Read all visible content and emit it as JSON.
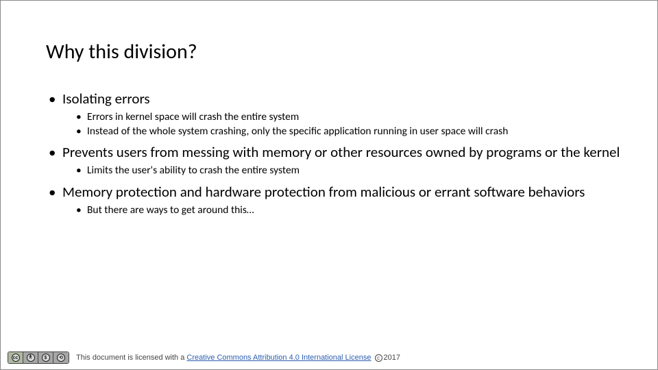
{
  "slide": {
    "title": "Why this division?",
    "bullets": [
      {
        "text": "Isolating errors",
        "children": [
          "Errors in kernel space will crash the entire system",
          "Instead of the whole system crashing, only the specific application running in user space will crash"
        ]
      },
      {
        "text": "Prevents users from messing with memory or other resources owned by programs or the kernel",
        "children": [
          "Limits the user's ability to crash the entire system"
        ]
      },
      {
        "text": "Memory protection and hardware protection from malicious or errant software behaviors",
        "children": [
          "But there are ways to get around this…"
        ]
      }
    ]
  },
  "footer": {
    "prefix": "This document is licensed with a ",
    "link_text": "Creative Commons Attribution 4.0 International License",
    "year": "2017",
    "cc_marks": [
      "cc",
      "BY",
      "NC",
      "SA"
    ]
  }
}
